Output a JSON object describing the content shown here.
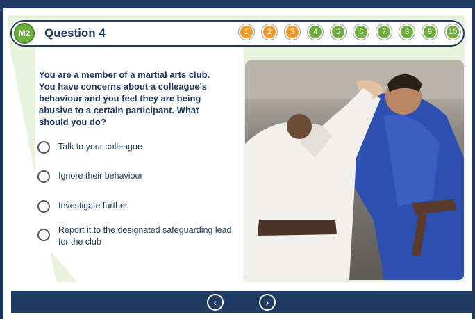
{
  "module_badge": "M2",
  "question_title": "Question 4",
  "steps": [
    "1",
    "2",
    "3",
    "4",
    "5",
    "6",
    "7",
    "8",
    "9",
    "10"
  ],
  "step_states": [
    "orange",
    "orange",
    "orange",
    "green",
    "green",
    "green",
    "green",
    "green",
    "green",
    "green"
  ],
  "question_text": "You are a member of a martial arts club. You have concerns about a colleague's behaviour and you feel they are being abusive to a certain participant. What should you do?",
  "options": [
    "Talk to your colleague",
    "Ignore their behaviour",
    "Investigate further",
    "Report it to the designated safeguarding lead for the club"
  ],
  "nav": {
    "prev": "‹",
    "next": "›"
  },
  "colors": {
    "navy": "#1f3a63",
    "green": "#6dae3a",
    "orange": "#f39a2b"
  }
}
